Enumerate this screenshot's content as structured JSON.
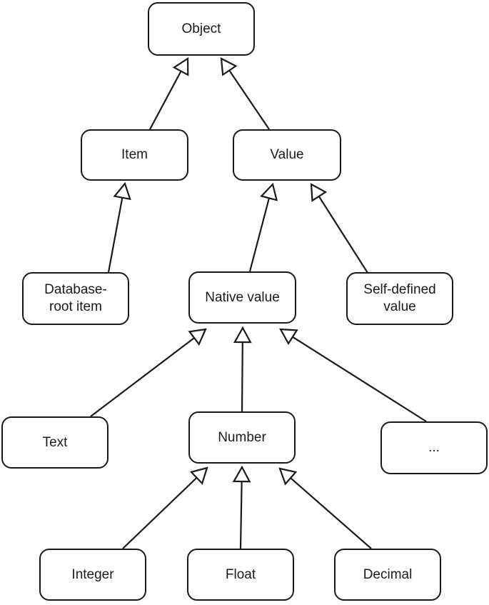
{
  "nodes": [
    {
      "id": "object",
      "label": "Object"
    },
    {
      "id": "item",
      "label": "Item"
    },
    {
      "id": "value",
      "label": "Value"
    },
    {
      "id": "database-root-item",
      "label": "Database-\nroot item"
    },
    {
      "id": "native-value",
      "label": "Native value"
    },
    {
      "id": "self-defined-value",
      "label": "Self-defined\nvalue"
    },
    {
      "id": "text",
      "label": "Text"
    },
    {
      "id": "number",
      "label": "Number"
    },
    {
      "id": "more",
      "label": "..."
    },
    {
      "id": "integer",
      "label": "Integer"
    },
    {
      "id": "float",
      "label": "Float"
    },
    {
      "id": "decimal",
      "label": "Decimal"
    }
  ],
  "edges": [
    {
      "from": "item",
      "to": "object",
      "type": "generalization"
    },
    {
      "from": "value",
      "to": "object",
      "type": "generalization"
    },
    {
      "from": "database-root-item",
      "to": "item",
      "type": "generalization"
    },
    {
      "from": "native-value",
      "to": "value",
      "type": "generalization"
    },
    {
      "from": "self-defined-value",
      "to": "value",
      "type": "generalization"
    },
    {
      "from": "text",
      "to": "native-value",
      "type": "generalization"
    },
    {
      "from": "number",
      "to": "native-value",
      "type": "generalization"
    },
    {
      "from": "more",
      "to": "native-value",
      "type": "generalization"
    },
    {
      "from": "integer",
      "to": "number",
      "type": "generalization"
    },
    {
      "from": "float",
      "to": "number",
      "type": "generalization"
    },
    {
      "from": "decimal",
      "to": "number",
      "type": "generalization"
    }
  ]
}
